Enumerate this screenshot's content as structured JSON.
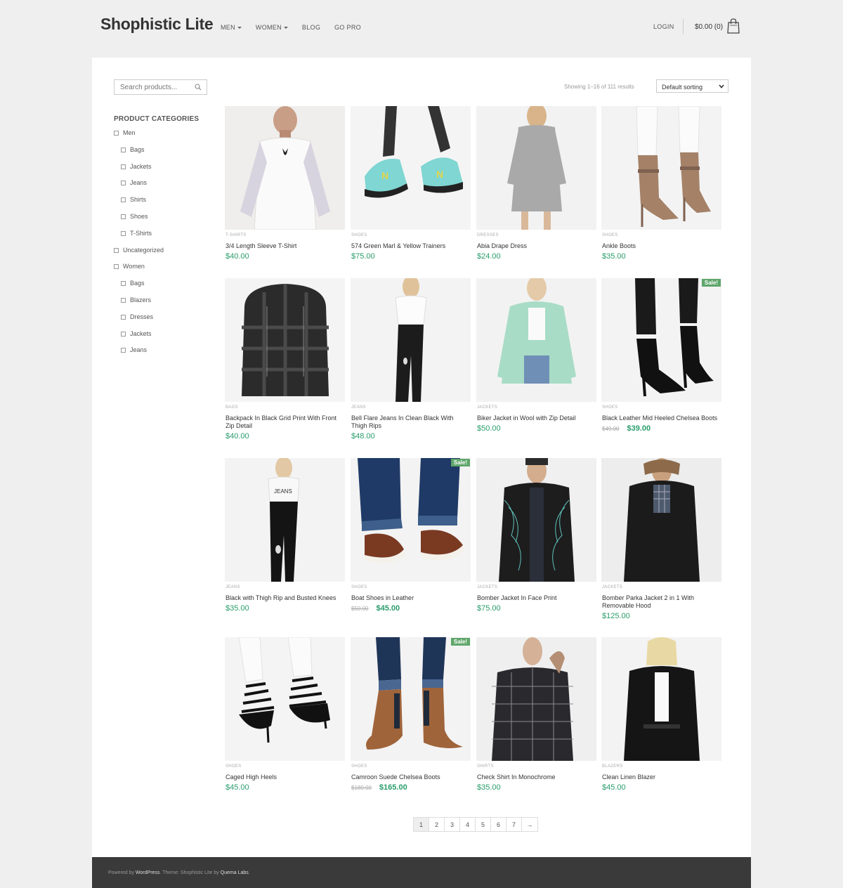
{
  "header": {
    "logo": "Shophistic Lite",
    "nav": [
      {
        "label": "MEN",
        "dropdown": true
      },
      {
        "label": "WOMEN",
        "dropdown": true
      },
      {
        "label": "BLOG",
        "dropdown": false
      },
      {
        "label": "GO PRO",
        "dropdown": false
      }
    ],
    "login": "LOGIN",
    "cart_total": "$0.00 (0)",
    "cart_icon": "shopping-bag-icon"
  },
  "sidebar": {
    "search_placeholder": "Search products...",
    "search_icon": "magnifier-icon",
    "categories_title": "PRODUCT CATEGORIES",
    "categories": [
      {
        "label": "Men",
        "level": 0
      },
      {
        "label": "Bags",
        "level": 1
      },
      {
        "label": "Jackets",
        "level": 1
      },
      {
        "label": "Jeans",
        "level": 1
      },
      {
        "label": "Shirts",
        "level": 1
      },
      {
        "label": "Shoes",
        "level": 1
      },
      {
        "label": "T-Shirts",
        "level": 1
      },
      {
        "label": "Uncategorized",
        "level": 0
      },
      {
        "label": "Women",
        "level": 0
      },
      {
        "label": "Bags",
        "level": 1
      },
      {
        "label": "Blazers",
        "level": 1
      },
      {
        "label": "Dresses",
        "level": 1
      },
      {
        "label": "Jackets",
        "level": 1
      },
      {
        "label": "Jeans",
        "level": 1
      }
    ]
  },
  "toolbar": {
    "result_count": "Showing 1–16 of 111 results",
    "sort_selected": "Default sorting"
  },
  "products": [
    {
      "category": "T-SHIRTS",
      "name": "3/4 Length Sleeve T-Shirt",
      "price": "$40.00",
      "old_price": null,
      "sale": false,
      "image": "white-raglan-tshirt-model"
    },
    {
      "category": "SHOES",
      "name": "574 Green Marl & Yellow Trainers",
      "price": "$75.00",
      "old_price": null,
      "sale": false,
      "image": "teal-trainers"
    },
    {
      "category": "DRESSES",
      "name": "Abia Drape Dress",
      "price": "$24.00",
      "old_price": null,
      "sale": false,
      "image": "grey-drape-dress-model"
    },
    {
      "category": "SHOES",
      "name": "Ankle Boots",
      "price": "$35.00",
      "old_price": null,
      "sale": false,
      "image": "tan-heeled-ankle-boots"
    },
    {
      "category": "BAGS",
      "name": "Backpack In Black Grid Print With Front Zip Detail",
      "price": "$40.00",
      "old_price": null,
      "sale": false,
      "image": "black-grid-backpack"
    },
    {
      "category": "JEANS",
      "name": "Bell Flare Jeans In Clean Black With Thigh Rips",
      "price": "$48.00",
      "old_price": null,
      "sale": false,
      "image": "black-flare-jeans-model"
    },
    {
      "category": "JACKETS",
      "name": "Biker Jacket in Wool with Zip Detail",
      "price": "$50.00",
      "old_price": null,
      "sale": false,
      "image": "mint-biker-jacket-model"
    },
    {
      "category": "SHOES",
      "name": "Black Leather Mid Heeled Chelsea Boots",
      "price": "$39.00",
      "old_price": "$49.00",
      "sale": true,
      "image": "black-heeled-chelsea-boots"
    },
    {
      "category": "JEANS",
      "name": "Black with Thigh Rip and Busted Knees",
      "price": "$35.00",
      "old_price": null,
      "sale": false,
      "image": "black-ripped-jeans-model"
    },
    {
      "category": "SHOES",
      "name": "Boat Shoes in Leather",
      "price": "$45.00",
      "old_price": "$50.00",
      "sale": true,
      "image": "brown-boat-shoes"
    },
    {
      "category": "JACKETS",
      "name": "Bomber Jacket In Face Print",
      "price": "$75.00",
      "old_price": null,
      "sale": false,
      "image": "face-print-bomber-model"
    },
    {
      "category": "JACKETS",
      "name": "Bomber Parka Jacket 2 in 1 With Removable Hood",
      "price": "$125.00",
      "old_price": null,
      "sale": false,
      "image": "black-parka-model"
    },
    {
      "category": "SHOES",
      "name": "Caged High Heels",
      "price": "$45.00",
      "old_price": null,
      "sale": false,
      "image": "black-caged-heels"
    },
    {
      "category": "SHOES",
      "name": "Camroon Suede Chelsea Boots",
      "price": "$165.00",
      "old_price": "$180.00",
      "sale": true,
      "image": "tan-suede-chelsea-boots"
    },
    {
      "category": "SHIRTS",
      "name": "Check Shirt In Monochrome",
      "price": "$35.00",
      "old_price": null,
      "sale": false,
      "image": "monochrome-check-shirt-model"
    },
    {
      "category": "BLAZERS",
      "name": "Clean Linen Blazer",
      "price": "$45.00",
      "old_price": null,
      "sale": false,
      "image": "black-linen-blazer-model"
    }
  ],
  "sale_badge": "Sale!",
  "pagination": [
    "1",
    "2",
    "3",
    "4",
    "5",
    "6",
    "7",
    "→"
  ],
  "pagination_current": "1",
  "footer": {
    "prefix": "Powered by ",
    "wp": "WordPress",
    "mid": ". Theme: Shophistic Lite by ",
    "author": "Quema Labs",
    "suffix": "."
  },
  "colors": {
    "price": "#2a9d6c",
    "sale_badge": "#5fa66b",
    "footer_bg": "#3a3a3a",
    "page_bg": "#efefef"
  }
}
